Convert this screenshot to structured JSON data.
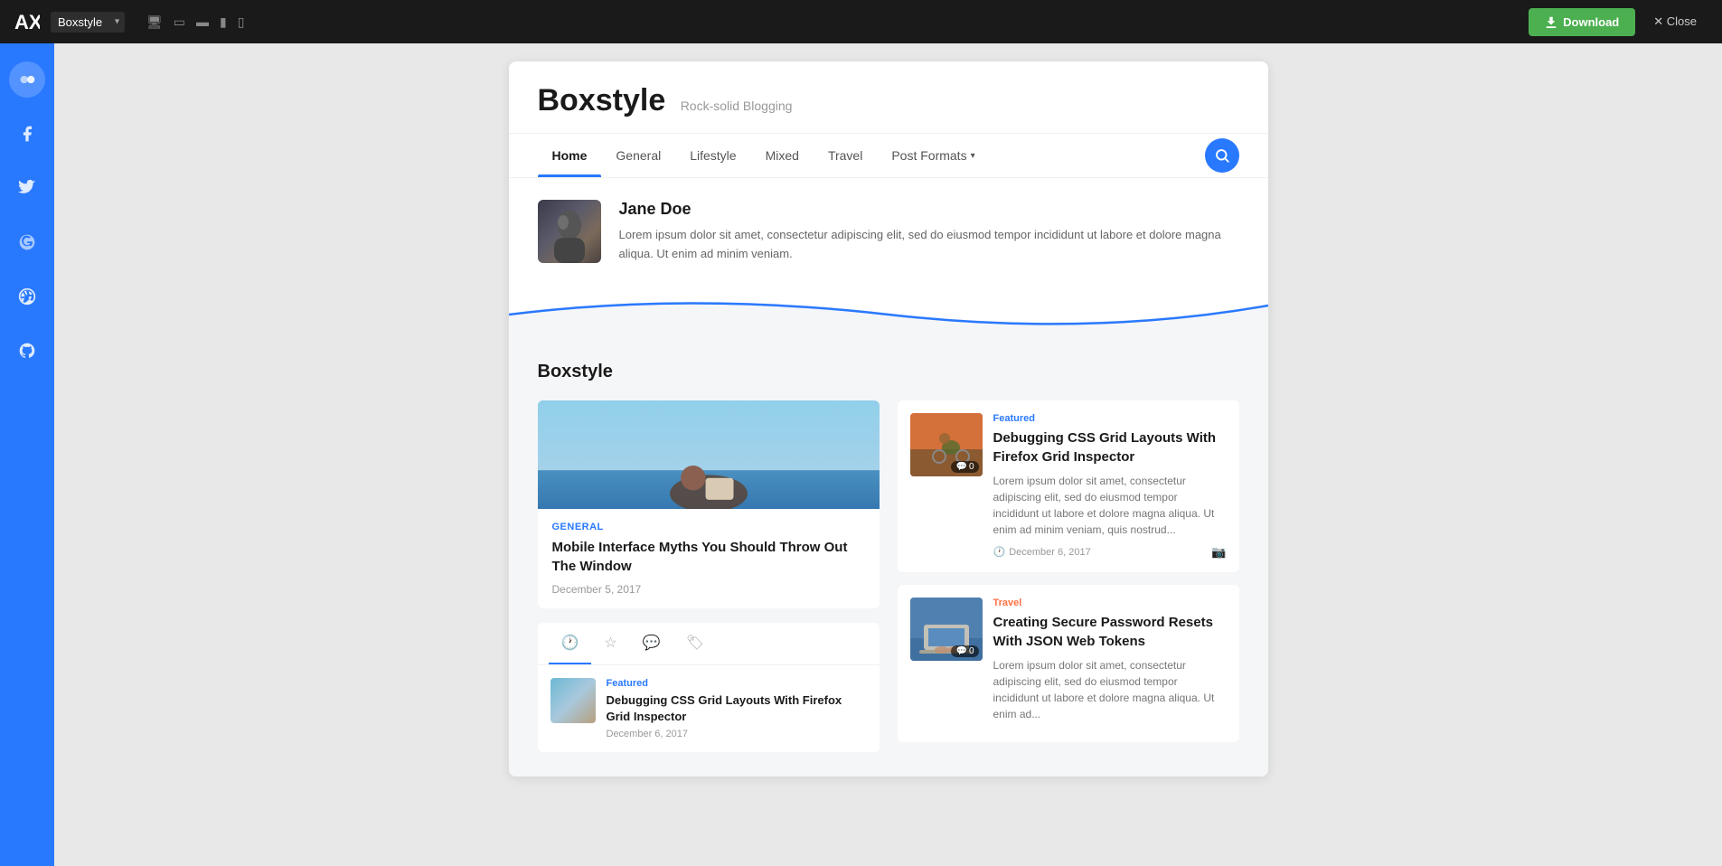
{
  "topbar": {
    "logo_text": "AX",
    "site_select": "Boxstyle",
    "download_label": "Download",
    "close_label": "✕ Close",
    "devices": [
      "desktop",
      "tablet-lg",
      "tablet",
      "mobile-lg",
      "mobile"
    ]
  },
  "sidebar": {
    "items": [
      {
        "name": "toggle-icon",
        "label": "Toggle"
      },
      {
        "name": "facebook-icon",
        "label": "Facebook"
      },
      {
        "name": "twitter-icon",
        "label": "Twitter"
      },
      {
        "name": "google-icon",
        "label": "Google"
      },
      {
        "name": "dribbble-icon",
        "label": "Dribbble"
      },
      {
        "name": "github-icon",
        "label": "GitHub"
      }
    ]
  },
  "site": {
    "title": "Boxstyle",
    "tagline": "Rock-solid Blogging"
  },
  "nav": {
    "items": [
      {
        "label": "Home",
        "active": true
      },
      {
        "label": "General",
        "active": false
      },
      {
        "label": "Lifestyle",
        "active": false
      },
      {
        "label": "Mixed",
        "active": false
      },
      {
        "label": "Travel",
        "active": false
      },
      {
        "label": "Post Formats",
        "active": false,
        "has_dropdown": true
      }
    ]
  },
  "author": {
    "name": "Jane Doe",
    "bio": "Lorem ipsum dolor sit amet, consectetur adipiscing elit, sed do eiusmod tempor incididunt ut labore et dolore magna aliqua. Ut enim ad minim veniam."
  },
  "blog_section": {
    "title": "Boxstyle",
    "left_post": {
      "category": "General",
      "title": "Mobile Interface Myths You Should Throw Out The Window",
      "date": "December 5, 2017"
    },
    "tabs_post": {
      "category": "Featured",
      "title": "Debugging CSS Grid Layouts With Firefox Grid Inspector",
      "date": "December 6, 2017"
    },
    "right_posts": [
      {
        "category": "Featured",
        "category_class": "cat-featured",
        "title": "Debugging CSS Grid Layouts With Firefox Grid Inspector",
        "excerpt": "Lorem ipsum dolor sit amet, consectetur adipiscing elit, sed do eiusmod tempor incididunt ut labore et dolore magna aliqua. Ut enim ad minim veniam, quis nostrud...",
        "date": "December 6, 2017",
        "comment_count": "0",
        "thumb_class": "right-post-thumb-1"
      },
      {
        "category": "Travel",
        "category_class": "cat-travel",
        "title": "Creating Secure Password Resets With JSON Web Tokens",
        "excerpt": "Lorem ipsum dolor sit amet, consectetur adipiscing elit, sed do eiusmod tempor incididunt ut labore et dolore magna aliqua. Ut enim ad...",
        "date": "December 6, 2017",
        "comment_count": "0",
        "thumb_class": "right-post-thumb-2"
      }
    ]
  }
}
